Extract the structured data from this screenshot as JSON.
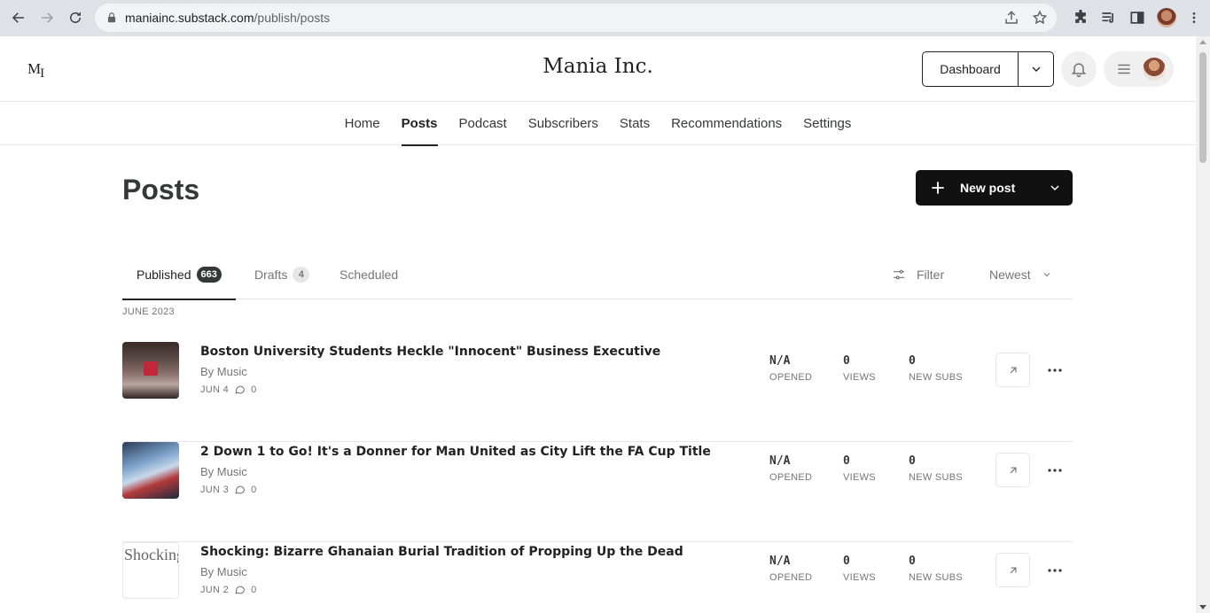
{
  "browser": {
    "url_host": "maniainc.substack.com",
    "url_path": "/publish/posts"
  },
  "header": {
    "logo": "M",
    "logo_sub": "I",
    "publication_title": "Mania Inc.",
    "dashboard_label": "Dashboard"
  },
  "nav": {
    "tabs": [
      {
        "label": "Home",
        "active": false
      },
      {
        "label": "Posts",
        "active": true
      },
      {
        "label": "Podcast",
        "active": false
      },
      {
        "label": "Subscribers",
        "active": false
      },
      {
        "label": "Stats",
        "active": false
      },
      {
        "label": "Recommendations",
        "active": false
      },
      {
        "label": "Settings",
        "active": false
      }
    ]
  },
  "main": {
    "heading": "Posts",
    "new_post_label": "New post",
    "post_tabs": {
      "published_label": "Published",
      "published_count": "663",
      "drafts_label": "Drafts",
      "drafts_count": "4",
      "scheduled_label": "Scheduled"
    },
    "filter_label": "Filter",
    "sort_label": "Newest",
    "section_label": "JUNE 2023",
    "stat_labels": {
      "opened": "OPENED",
      "views": "VIEWS",
      "new_subs": "NEW SUBS"
    },
    "posts": [
      {
        "title": "Boston University Students Heckle \"Innocent\" Business Executive",
        "byline": "By Music",
        "date": "JUN 4",
        "comments": "0",
        "opened": "N/A",
        "views": "0",
        "new_subs": "0"
      },
      {
        "title": "2 Down 1 to Go! It's a Donner for Man United as City Lift the FA Cup Title",
        "byline": "By Music",
        "date": "JUN 3",
        "comments": "0",
        "opened": "N/A",
        "views": "0",
        "new_subs": "0"
      },
      {
        "title": "Shocking: Bizarre Ghanaian Burial Tradition of Propping Up the Dead",
        "byline": "By Music",
        "date": "JUN 2",
        "comments": "0",
        "opened": "N/A",
        "views": "0",
        "new_subs": "0",
        "thumb_alt": "Shocking: Bizarre"
      }
    ]
  }
}
